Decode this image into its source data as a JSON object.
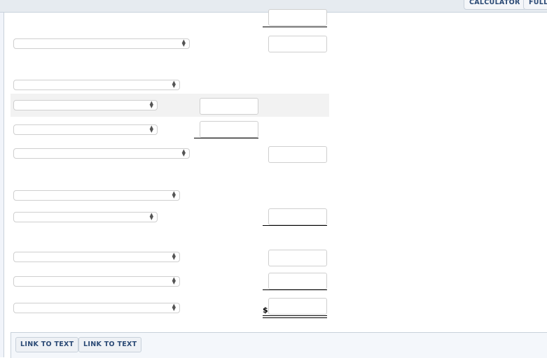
{
  "toolbar": {
    "calculator_label": "CALCULATOR",
    "full_label": "FULL"
  },
  "form": {
    "rows": [
      {
        "select": "",
        "input": ""
      },
      {
        "select": "",
        "input": ""
      },
      {
        "select": ""
      },
      {
        "select": "",
        "input": ""
      },
      {
        "select": "",
        "input": ""
      },
      {
        "select": "",
        "input": ""
      },
      {
        "select": ""
      },
      {
        "select": "",
        "input": ""
      },
      {
        "select": "",
        "input": ""
      },
      {
        "select": "",
        "input": ""
      },
      {
        "select": "",
        "input": ""
      }
    ],
    "currency_symbol": "$"
  },
  "footer": {
    "link1_label": "LINK TO TEXT",
    "link2_label": "LINK TO TEXT"
  }
}
